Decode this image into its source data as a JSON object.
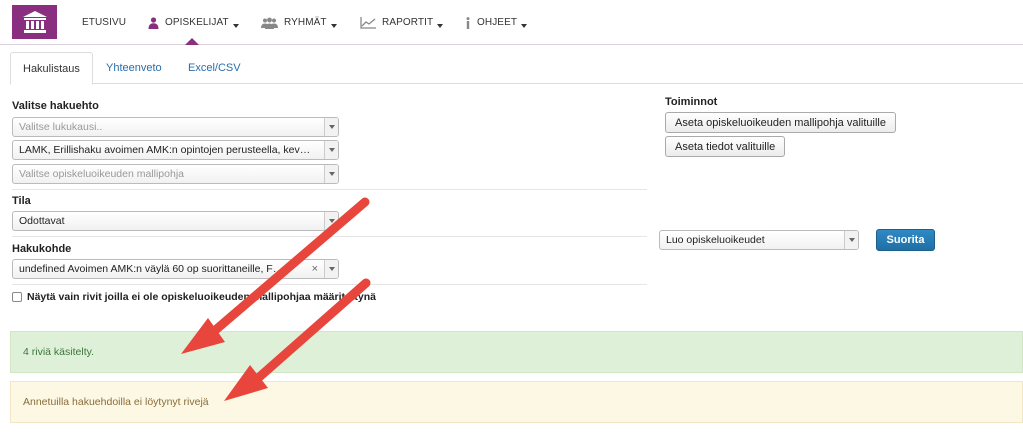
{
  "nav": {
    "items": [
      {
        "label": "ETUSIVU",
        "caret": false
      },
      {
        "label": "OPISKELIJAT",
        "caret": true
      },
      {
        "label": "RYHMÄT",
        "caret": true
      },
      {
        "label": "RAPORTIT",
        "caret": true
      },
      {
        "label": "OHJEET",
        "caret": true
      }
    ],
    "active": "OPISKELIJAT",
    "brand_color": "#8a2e7f"
  },
  "tabs": [
    {
      "label": "Hakulistaus",
      "active": true
    },
    {
      "label": "Yhteenveto",
      "active": false
    },
    {
      "label": "Excel/CSV",
      "active": false
    }
  ],
  "search": {
    "label": "Valitse hakuehto",
    "semester_placeholder": "Valitse lukukausi..",
    "application_value": "LAMK, Erillishaku avoimen AMK:n opintojen perusteella, kev…",
    "template_placeholder": "Valitse opiskeluoikeuden mallipohja"
  },
  "status": {
    "label": "Tila",
    "value": "Odottavat"
  },
  "target": {
    "label": "Hakukohde",
    "value": "undefined Avoimen AMK:n väylä 60 op suorittaneille, F…"
  },
  "filter_checkbox": {
    "label": "Näytä vain rivit joilla ei ole opiskeluoikeuden mallipohjaa määritettynä",
    "checked": false
  },
  "actions": {
    "label": "Toiminnot",
    "set_template_button": "Aseta opiskeluoikeuden mallipohja valituille",
    "set_details_button": "Aseta tiedot valituille",
    "operation_select": "Luo opiskeluoikeudet",
    "run_button": "Suorita",
    "run_button_color": "#2a7ab8"
  },
  "alerts": {
    "success": "4 riviä käsitelty.",
    "warning": "Annetuilla hakuehdoilla ei löytynyt rivejä"
  },
  "annotation_color": "#e8463c"
}
